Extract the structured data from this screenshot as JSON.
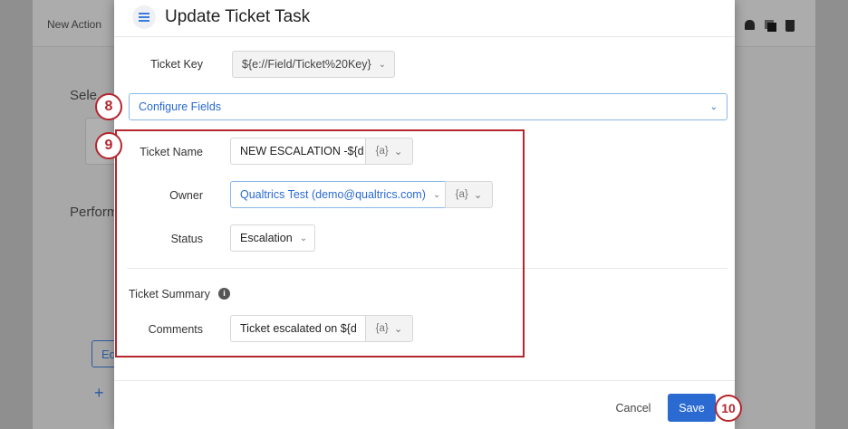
{
  "background": {
    "header_label": "New Action",
    "select_label": "Sele",
    "perform_label": "Perform",
    "edit_label": "Ed",
    "add_icon": "+"
  },
  "modal": {
    "title": "Update Ticket Task",
    "ticket_key": {
      "label": "Ticket Key",
      "value": "${e://Field/Ticket%20Key}"
    },
    "configure_fields": "Configure Fields",
    "ticket_name": {
      "label": "Ticket Name",
      "value": "NEW ESCALATION -${d",
      "piping": "{a}"
    },
    "owner": {
      "label": "Owner",
      "value": "Qualtrics Test (demo@qualtrics.com)",
      "piping": "{a}"
    },
    "status": {
      "label": "Status",
      "value": "Escalation"
    },
    "ticket_summary": "Ticket Summary",
    "comments": {
      "label": "Comments",
      "value": "Ticket escalated on ${d",
      "piping": "{a}"
    },
    "cancel": "Cancel",
    "save": "Save"
  },
  "callouts": {
    "c8": "8",
    "c9": "9",
    "c10": "10"
  },
  "colors": {
    "accent": "#2a6ad1",
    "callout": "#b5262e"
  }
}
